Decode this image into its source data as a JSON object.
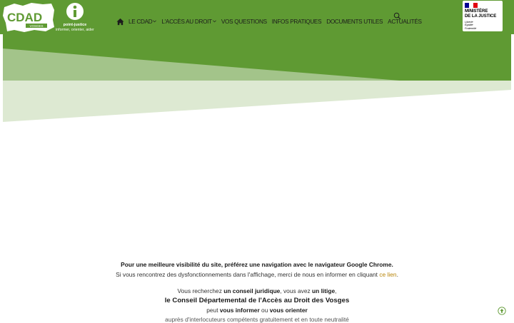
{
  "logos": {
    "cdad_text": "CDAD",
    "cdad_sub": "VOSGES",
    "point_justice_name": "point-justice",
    "point_justice_tagline": "informer, orienter, aider"
  },
  "nav": {
    "items": [
      {
        "label": "LE CDAD"
      },
      {
        "label": "L'ACCÈS AU DROIT"
      },
      {
        "label": "VOS QUESTIONS"
      },
      {
        "label": "INFOS PRATIQUES"
      },
      {
        "label": "DOCUMENTS UTILES"
      },
      {
        "label": "ACTUALITÉS"
      }
    ]
  },
  "ministere": {
    "line1": "MINISTÈRE",
    "line2": "DE LA JUSTICE",
    "motto": [
      "Liberté",
      "Égalité",
      "Fraternité"
    ]
  },
  "content": {
    "chrome_notice": "Pour une meilleure visibilité du site, préférez une navigation avec le navigateur Google Chrome.",
    "issues_before": "Si vous rencontrez des dysfonctionnements dans l'affichage, merci de nous en informer en cliquant ",
    "issues_link": "ce lien",
    "issues_after": ".",
    "intro_pre": "Vous recherchez ",
    "intro_b1": "un conseil juridique",
    "intro_mid": ", vous avez ",
    "intro_b2": "un litige",
    "intro_end": ",",
    "org_name": "le Conseil Départemental de l'Accès au Droit des Vosges",
    "inform_pre": "peut ",
    "inform_b1": "vous informer",
    "inform_mid": " ou ",
    "inform_b2": "vous orienter",
    "cut_line": "auprès d'interlocuteurs compétents gratuitement et en toute neutralité"
  },
  "colors": {
    "header_green": "#5f9a33",
    "hero_mid_green": "#a3c48a",
    "hero_light_green": "#dde9d2",
    "link": "#b8860b"
  }
}
